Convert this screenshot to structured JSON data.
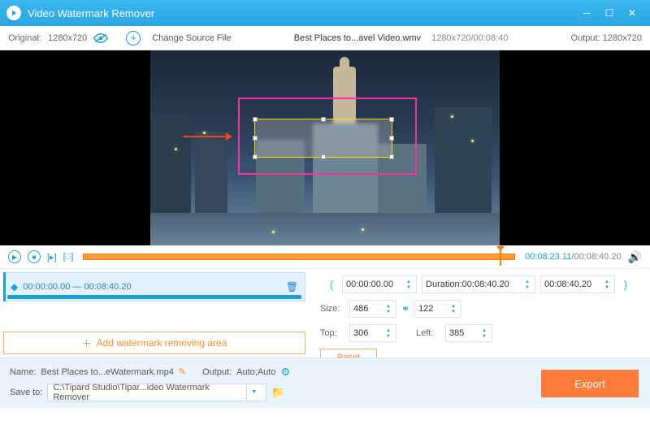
{
  "titlebar": {
    "title": "Video Watermark Remover"
  },
  "toolbar": {
    "original_label": "Original:",
    "original_res": "1280x720",
    "change_source": "Change Source File",
    "filename": "Best Places to...avel Video.wmv",
    "meta": "1280x720/00:08:40",
    "output_label": "Output:",
    "output_res": "1280x720"
  },
  "playbar": {
    "time_current": "00:08:23.11",
    "time_total": "/00:08:40.20"
  },
  "segment": {
    "range": "00:00:00.00 — 00:08:40.20"
  },
  "addarea_label": "Add watermark removing area",
  "timerow": {
    "start": "00:00:00.00",
    "duration_label": "Duration:",
    "duration": "00:08:40.20",
    "end": "00:08:40.20"
  },
  "sizerow": {
    "label": "Size:",
    "w": "486",
    "h": "122"
  },
  "posrow": {
    "top_label": "Top:",
    "top": "306",
    "left_label": "Left:",
    "left": "385"
  },
  "reset_label": "Reset",
  "bottom": {
    "name_label": "Name:",
    "name": "Best Places to...eWatermark.mp4",
    "output_label": "Output:",
    "output": "Auto;Auto",
    "saveto_label": "Save to:",
    "saveto_path": "C:\\Tipard Studio\\Tipar...ideo Watermark Remover",
    "export": "Export"
  }
}
